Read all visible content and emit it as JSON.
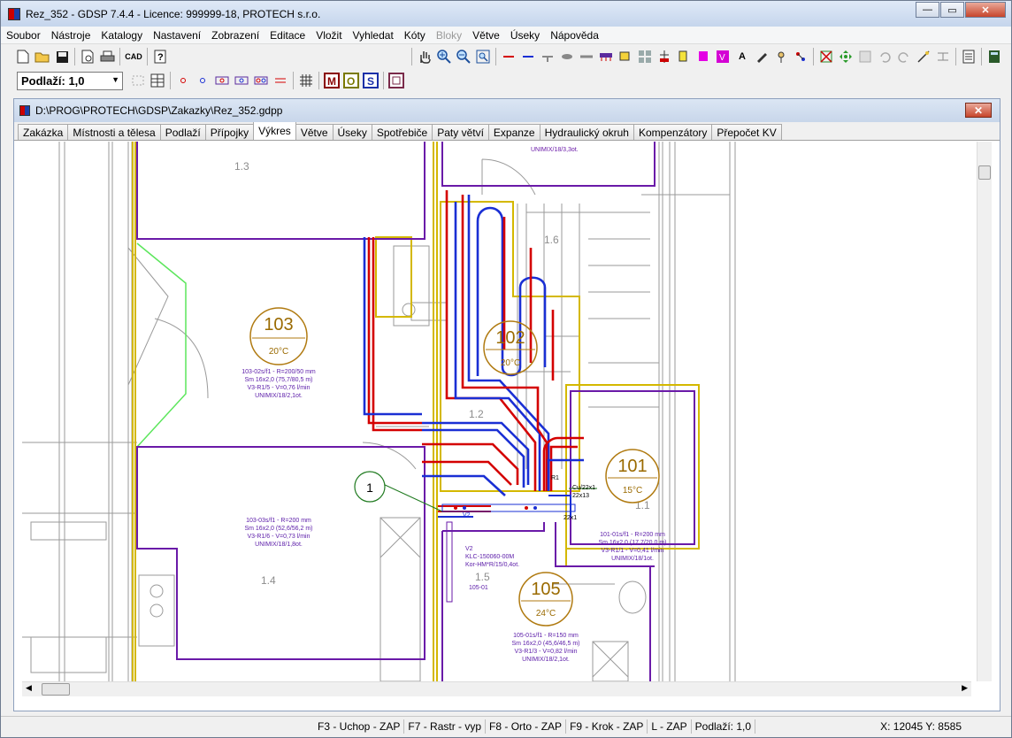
{
  "window": {
    "title": "Rez_352 - GDSP 7.4.4 -  Licence: 999999-18, PROTECH s.r.o."
  },
  "menu": [
    "Soubor",
    "Nástroje",
    "Katalogy",
    "Nastavení",
    "Zobrazení",
    "Editace",
    "Vložit",
    "Vyhledat",
    "Kóty",
    "Bloky",
    "Větve",
    "Úseky",
    "Nápověda"
  ],
  "menu_disabled_index": 9,
  "toolbar": {
    "cad_label": "CAD",
    "m_label": "M",
    "o_label": "O",
    "s_label": "S",
    "a_label": "A",
    "v_label": "V"
  },
  "floor_combo": {
    "value": "Podlaží: 1,0"
  },
  "document": {
    "path": "D:\\PROG\\PROTECH\\GDSP\\Zakazky\\Rez_352.gdpp"
  },
  "tabs": [
    "Zakázka",
    "Místnosti a tělesa",
    "Podlaží",
    "Přípojky",
    "Výkres",
    "Větve",
    "Úseky",
    "Spotřebiče",
    "Paty větví",
    "Expanze",
    "Hydraulický okruh",
    "Kompenzátory",
    "Přepočet KV"
  ],
  "active_tab": 4,
  "drawing": {
    "rooms": [
      {
        "id": "103",
        "temp": "20°C",
        "lines": [
          "103-02s/f1 - R=200/50 mm",
          "Sm 16x2,0 (75,7/80,5 m)",
          "V3-R1/5 - V=0,76 l/min",
          "UNIMIX/18/2,1ot."
        ]
      },
      {
        "id": "102",
        "temp": "20°C"
      },
      {
        "id": "101",
        "temp": "15°C",
        "lines": [
          "101-01s/f1 - R=200 mm",
          "Sm 16x2,0 (17,7/20,0 m)",
          "V3-R1/1 - V=0,41 l/min",
          "UNIMIX/18/1ot."
        ]
      },
      {
        "id": "105",
        "temp": "24°C",
        "lines": [
          "105-01s/f1 - R=150 mm",
          "Sm 16x2,0 (45,6/46,5 m)",
          "V3-R1/3 - V=0,82 l/min",
          "UNIMIX/18/2,1ot."
        ]
      }
    ],
    "room_104_lines": [
      "103-03s/f1 - R=200 mm",
      "Sm 16x2,0 (52,6/56,2 m)",
      "V3-R1/6 - V=0,73 l/min",
      "UNIMIX/18/1,8ot."
    ],
    "top_text": "UNIMIX/18/3,3ot.",
    "area_labels": [
      "1.3",
      "1.6",
      "1.2",
      "1.1",
      "1.4",
      "1.5"
    ],
    "marker": "1",
    "valve_lines": [
      "V2",
      "KLC-150060-00M",
      "Kor-HM*R/15/0,4ot.",
      "105-01"
    ],
    "pipe_labels": [
      "Cu/22x1",
      "22x13",
      "22x1",
      "R1",
      "V2"
    ]
  },
  "status": {
    "items": [
      "F3 - Uchop - ZAP",
      "F7 - Rastr - vyp",
      "F8 - Orto - ZAP",
      "F9 - Krok - ZAP",
      "L - ZAP",
      "Podlaží: 1,0"
    ],
    "coords": "X: 12045 Y: 8585"
  }
}
